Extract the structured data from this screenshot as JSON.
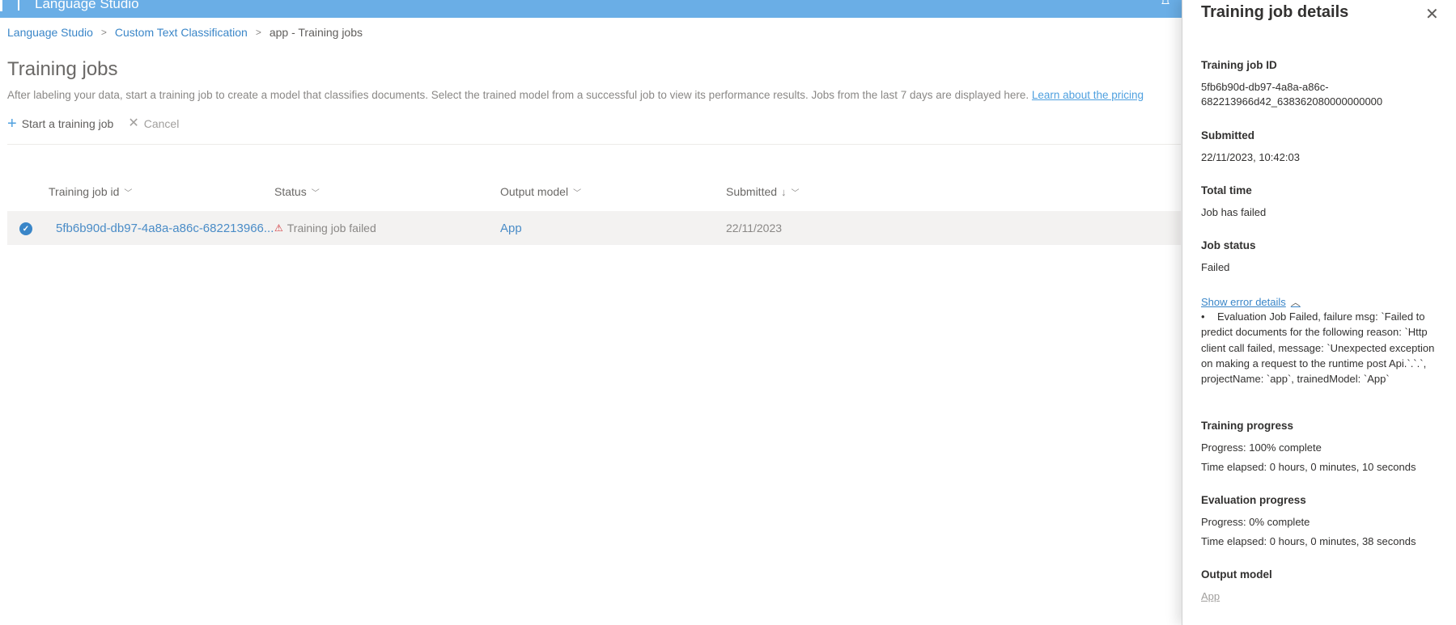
{
  "topbar": {
    "title": "Language Studio",
    "bell_icon": "bell-icon"
  },
  "breadcrumb": {
    "items": [
      "Language Studio",
      "Custom Text Classification"
    ],
    "current": "app - Training jobs",
    "separator": ">"
  },
  "page": {
    "title": "Training jobs",
    "description": "After labeling your data, start a training job to create a model that classifies documents. Select the trained model from a successful job to view its performance results. Jobs from the last 7 days are displayed here. ",
    "description_link": "Learn about the pricing"
  },
  "commands": {
    "start_label": "Start a training job",
    "cancel_label": "Cancel"
  },
  "table": {
    "columns": [
      "Training job id",
      "Status",
      "Output model",
      "Submitted"
    ],
    "sort_indicator": "↓",
    "rows": [
      {
        "job_id": "5fb6b90d-db97-4a8a-a86c-682213966...",
        "status": "Training job failed",
        "model": "App",
        "submitted": "22/11/2023"
      }
    ]
  },
  "panel": {
    "title": "Training job details",
    "close_glyph": "✕",
    "job_id_label": "Training job ID",
    "job_id_line1": "5fb6b90d-db97-4a8a-a86c-",
    "job_id_line2": "682213966d42_638362080000000000",
    "submitted_label": "Submitted",
    "submitted_value": "22/11/2023, 10:42:03",
    "total_time_label": "Total time",
    "total_time_value": "Job has failed",
    "job_status_label": "Job status",
    "job_status_value": "Failed",
    "error_toggle": "Show error details",
    "error_bullet": "•",
    "error_text": "Evaluation Job Failed, failure msg: `Failed to predict documents for the following reason: `Http client call failed, message: `Unexpected exception on making a request to the runtime post Api.`.`.`, projectName: `app`, trainedModel: `App`",
    "training_progress_label": "Training progress",
    "training_progress": "Progress: 100% complete",
    "training_elapsed": "Time elapsed: 0 hours, 0 minutes, 10 seconds",
    "evaluation_progress_label": "Evaluation progress",
    "evaluation_progress": "Progress: 0% complete",
    "evaluation_elapsed": "Time elapsed: 0 hours, 0 minutes, 38 seconds",
    "output_model_label": "Output model",
    "output_model_value": "App"
  },
  "colors": {
    "topbar": "#6aaee6",
    "link": "#3a86c8",
    "error": "#d13438"
  }
}
